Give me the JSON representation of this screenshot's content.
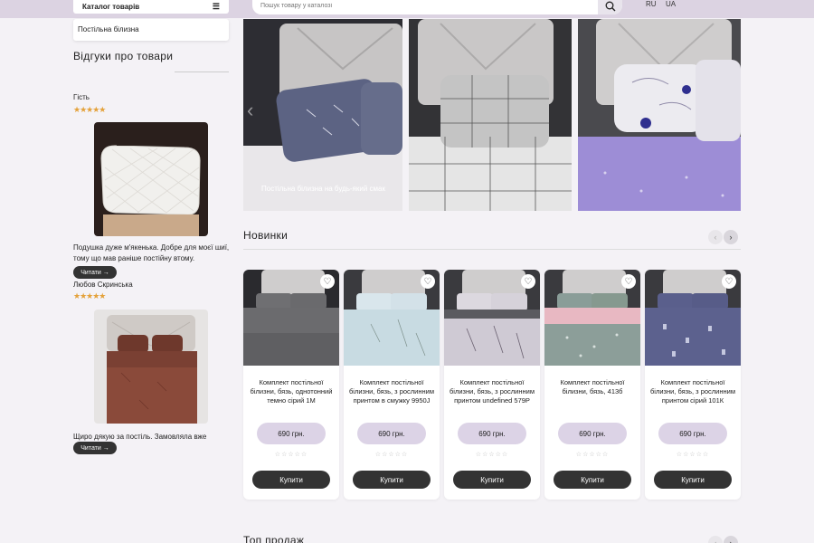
{
  "header": {
    "catalog_label": "Каталог товарів",
    "search_placeholder": "Пошук товару у каталозі",
    "lang_ru": "RU",
    "lang_ua": "UA"
  },
  "sidebar": {
    "dropdown_item": "Постільна білизна",
    "reviews_title": "Відгуки про товари",
    "reviews": [
      {
        "author": "Гість",
        "rating": 5,
        "text": "Подушка дуже м'якенька. Добре для моєї шиї, тому що мав раніше постійну втому.",
        "read_label": "Читати →"
      },
      {
        "author": "Любов Скринська",
        "rating": 5,
        "text": "Щиро дякую за постіль. Замовляла вже вдруге.",
        "read_label": "Читати →"
      }
    ]
  },
  "hero": {
    "caption": "Постільна білизна на будь-який смак"
  },
  "novelties": {
    "title": "Новинки",
    "products": [
      {
        "name": "Комплект постільної білизни, бязь, однотонний темно сірий 1М",
        "price": "690 грн.",
        "buy_label": "Купити"
      },
      {
        "name": "Комплект постільної білизни, бязь, з рослинним принтом в смужку 9950J",
        "price": "690 грн.",
        "buy_label": "Купити"
      },
      {
        "name": "Комплект постільної білизни, бязь, з рослинним принтом undefined 579P",
        "price": "690 грн.",
        "buy_label": "Купити"
      },
      {
        "name": "Комплект постільної білизни, бязь, 413б",
        "price": "690 грн.",
        "buy_label": "Купити"
      },
      {
        "name": "Комплект постільної білизни, бязь, з рослинним принтом сірий 101К",
        "price": "690 грн.",
        "buy_label": "Купити"
      }
    ]
  },
  "top_sales": {
    "title": "Топ продаж"
  },
  "colors": {
    "topbar": "#dcd3e2",
    "price_pill": "#dcd3e6",
    "button_dark": "#333333",
    "stars": "#e4a23b"
  }
}
